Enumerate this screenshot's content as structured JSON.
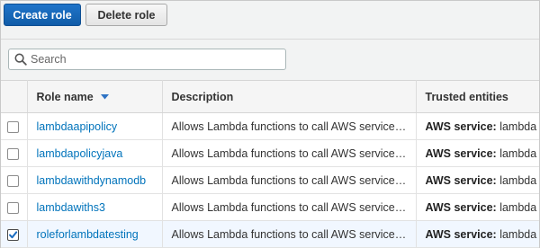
{
  "toolbar": {
    "create_label": "Create role",
    "delete_label": "Delete role"
  },
  "search": {
    "placeholder": "Search",
    "value": ""
  },
  "table": {
    "columns": {
      "role_name": "Role name",
      "description": "Description",
      "trusted_entities": "Trusted entities"
    },
    "sort": {
      "column": "role_name",
      "direction": "descending"
    },
    "rows": [
      {
        "selected": false,
        "role_name": "lambdaapipolicy",
        "description": "Allows Lambda functions to call AWS service…",
        "trusted_label": "AWS service:",
        "trusted_value": "lambda"
      },
      {
        "selected": false,
        "role_name": "lambdapolicyjava",
        "description": "Allows Lambda functions to call AWS service…",
        "trusted_label": "AWS service:",
        "trusted_value": "lambda"
      },
      {
        "selected": false,
        "role_name": "lambdawithdynamodb",
        "description": "Allows Lambda functions to call AWS service…",
        "trusted_label": "AWS service:",
        "trusted_value": "lambda"
      },
      {
        "selected": false,
        "role_name": "lambdawiths3",
        "description": "Allows Lambda functions to call AWS service…",
        "trusted_label": "AWS service:",
        "trusted_value": "lambda"
      },
      {
        "selected": true,
        "role_name": "roleforlambdatesting",
        "description": "Allows Lambda functions to call AWS service…",
        "trusted_label": "AWS service:",
        "trusted_value": "lambda"
      }
    ]
  },
  "colors": {
    "primary_button": "#1a6cc0",
    "link": "#0073bb",
    "sort_arrow": "#2e73c4",
    "selected_row": "#f1f7ff"
  }
}
